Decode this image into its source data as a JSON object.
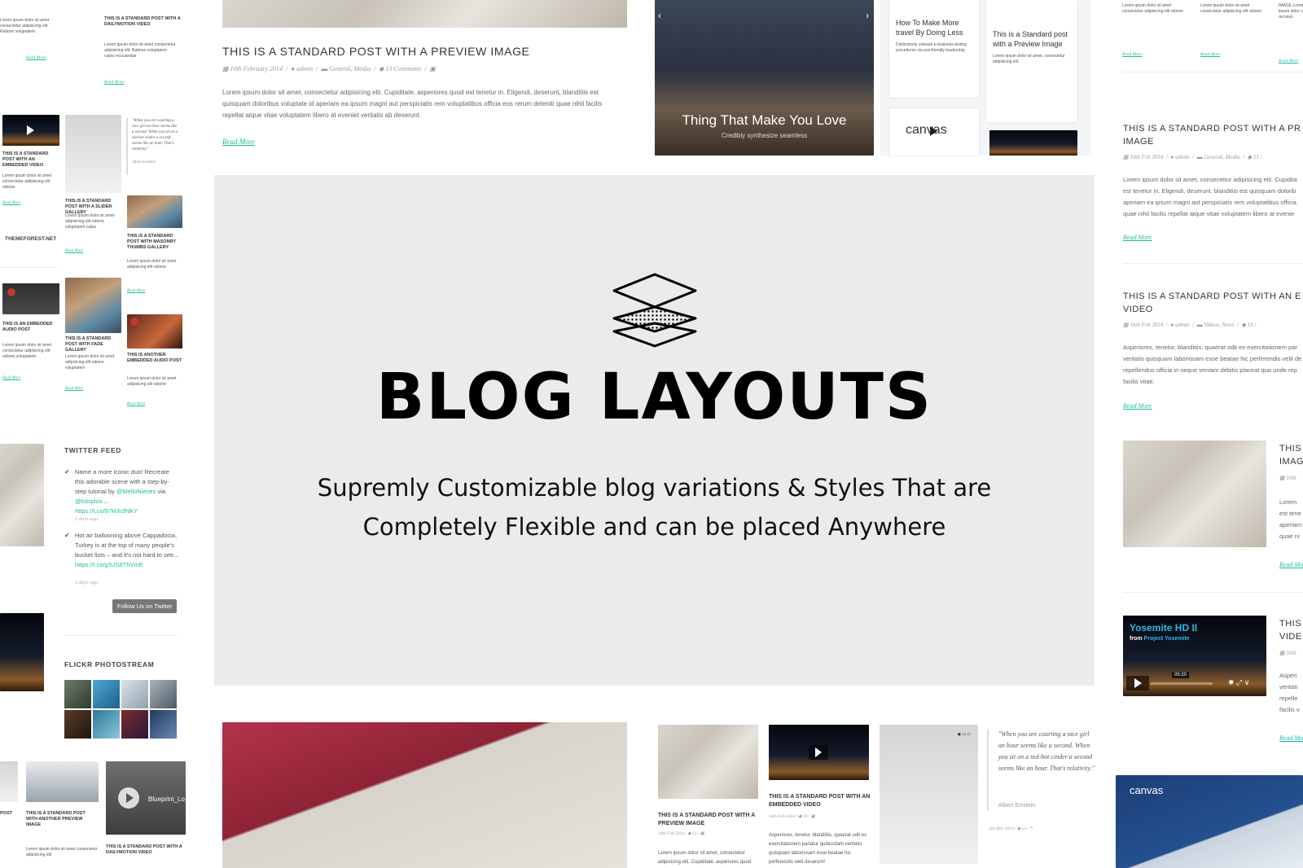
{
  "top_post": {
    "title": "THIS IS A STANDARD POST WITH A PREVIEW IMAGE",
    "date": "10th February 2014",
    "author": "admin",
    "categories": "General, Media",
    "comments": "13 Comments",
    "excerpt": "Lorem ipsum dolor sit amet, consectetur adipisicing elit. Cupiditate, asperiores quod est tenetur in. Eligendi, deserunt, blanditiis est quisquam doloribus voluptate id aperiam ea ipsum magni aut perspiciatis rem voluptatibus officia eos rerum deleniti quae nihil facilis repellat atque vitae voluptatem libero at eveniet veritatis ab deserunt.",
    "read_more": "Read More"
  },
  "slider": {
    "caption_title": "Thing That Make You Love",
    "caption_sub": "Credibly synthesize seamless"
  },
  "masonry_top": {
    "card1_title": "How To Make More travel By Doing Less",
    "card2_title": "This is a Standard post with a Preview Image",
    "card3_title": "canvas"
  },
  "hero": {
    "title": "BLOG LAYOUTS",
    "subtitle": "Supremly Customizable blog variations & Styles That are Completely Flexible and can be placed Anywhere"
  },
  "left_grid": {
    "posts": [
      {
        "title": "THIS IS A STANDARD POST WITH A DAILYMOTION VIDEO"
      },
      {
        "title": "THIS IS A STANDARD POST WITH AN EMBEDDED VIDEO"
      },
      {
        "title": "THIS IS A STANDARD POST WITH A SLIDER GALLERY"
      },
      {
        "title": "THIS IS A STANDARD POST WITH MASONRY THUMBS GALLERY"
      },
      {
        "title": "THIS IS AN EMBEDDED AUDIO POST"
      },
      {
        "title": "THIS IS A STANDARD POST WITH FADE GALLERY"
      },
      {
        "title": "THIS IS ANOTHER EMBEDDED AUDIO POST"
      }
    ],
    "quote": "\"When you are courting a nice girl an hour seems like a second. When you sit on a red-hot cinder a second seems like an hour. That's relativity.\"",
    "quote_author": "Albert Einstein",
    "link_post": "THEMEFOREST.NET",
    "read_more": "Read More"
  },
  "twitter": {
    "heading": "TWITTER FEED",
    "tweet1_text": "Name a more iconic duo! Recreate this adorable scene with a step-by-step tutorial by",
    "tweet1_handle": "@MelloNieves",
    "tweet1_via": "via",
    "tweet1_handle2": "@tutsplus",
    "tweet1_ellipsis": "...",
    "tweet1_link": "https://t.co/97ktXcfNKY",
    "tweet1_time": "2 days ago",
    "tweet2_text": "Hot air ballooning above Cappadocia, Turkey is at the top of many people's bucket lists – and it's not hard to see...",
    "tweet2_link": "https://t.co/gSJS6ThVmE",
    "tweet2_time": "3 days ago",
    "follow": "Follow Us on Twitter"
  },
  "flickr": {
    "heading": "FLICKR PHOTOSTREAM"
  },
  "bottom_left": {
    "post1_title": "THIS IS A STANDARD POST WITH ANOTHER PREVIEW IMAGE",
    "post2_title": "THIS IS A STANDARD POST WITH A DAILYMOTION VIDEO",
    "video_label": "Blueprint_Lo"
  },
  "bottom_grid": {
    "post1_title": "THIS IS A STANDARD POST WITH A PREVIEW IMAGE",
    "post1_meta": "10th Feb 2014",
    "post1_comments": "13",
    "post1_excerpt": "Lorem ipsum dolor sit amet, consectetur adipisicing elit. Cupiditate, asperiores quod",
    "post2_title": "THIS IS A STANDARD POST WITH AN EMBEDDED VIDEO",
    "post2_meta": "16th Feb 2014",
    "post2_comments": "19",
    "post2_excerpt": "Asperiores, tenetur, blanditiis, quaerat odit ex exercitationem pariatur quibusdam veritatis quisquam laboriosam esse beatae hic perferendis velit deserunt!",
    "quote": "\"When you are courting a nice girl an hour seems like a second. When you sit on a red-hot cinder a second seems like an hour. That's relativity.\"",
    "quote_author": "Albert Einstein",
    "quote_meta": "3rd Mar 2014",
    "quote_comments": "23"
  },
  "right_col": {
    "post1_title_l1": "THIS IS A STANDARD POST WITH A PR",
    "post1_title_l2": "IMAGE",
    "post1_date": "10th Feb 2014",
    "post1_author": "admin",
    "post1_cats": "General, Media",
    "post1_comments": "13",
    "post1_ex": [
      "Lorem ipsum dolor sit amet, consectetur adipisicing elit. Cupidita",
      "est tenetur in. Eligendi, deserunt, blanditiis est quisquam dolorib",
      "aperiam ea ipsum magni aut perspiciatis rem voluptatibus officia",
      "quae nihil facilis repellat atque vitae voluptatem libero at evenie"
    ],
    "post2_title_l1": "THIS IS A STANDARD POST WITH AN E",
    "post2_title_l2": "VIDEO",
    "post2_date": "16th Feb 2014",
    "post2_author": "admin",
    "post2_cats": "Videos, News",
    "post2_comments": "19",
    "post2_ex": [
      "Asperiores, tenetur, blanditiis, quaerat odit ex exercitationem par",
      "veritatis quisquam laboriosam esse beatae hic perferendis velit de",
      "repellendus officia in neque veniam debitis placeat quo unde rep",
      "facilis vitae."
    ],
    "post3_title": "THIS IMAG",
    "post4_title": "THIS VIDE",
    "video_title": "Yosemite HD II",
    "video_from": "from",
    "video_channel": "Project Yosemite",
    "video_time": "05:20",
    "canvas_label": "canvas",
    "read_more": "Read More"
  }
}
